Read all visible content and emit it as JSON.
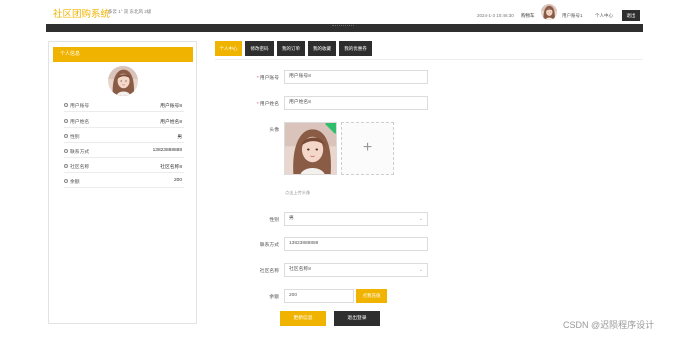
{
  "header": {
    "brand": "社区团购系统",
    "weather": "多云 1° 双 东北风 2级",
    "datetime": "2024-1-3 10:46:30",
    "cart": "购物车",
    "user": "用户账号1",
    "center": "个人中心",
    "logout": "退出"
  },
  "left": {
    "title": "个人信息",
    "rows": [
      {
        "label": "用户账号",
        "value": "用户账号8"
      },
      {
        "label": "用户姓名",
        "value": "用户姓名8"
      },
      {
        "label": "性别",
        "value": "男"
      },
      {
        "label": "联系方式",
        "value": "13823888888"
      },
      {
        "label": "社区名称",
        "value": "社区名称8"
      },
      {
        "label": "余额",
        "value": "200"
      }
    ]
  },
  "tabs": [
    "个人中心",
    "修改密码",
    "我的订单",
    "我的收藏",
    "我的优惠券"
  ],
  "form": {
    "account_label": "用户账号",
    "account_value": "用户账号8",
    "name_label": "用户姓名",
    "name_value": "用户姓名8",
    "avatar_label": "头像",
    "upload_plus": "+",
    "upload_hint": "点击上传头像",
    "gender_label": "性别",
    "gender_value": "男",
    "contact_label": "联系方式",
    "contact_value": "13823888888",
    "community_label": "社区名称",
    "community_value": "社区名称8",
    "balance_label": "余额",
    "balance_value": "200",
    "recharge": "点我充值",
    "update": "更新信息",
    "logout": "退出登录",
    "required_mark": "*"
  },
  "watermark": "CSDN @迟陨程序设计"
}
